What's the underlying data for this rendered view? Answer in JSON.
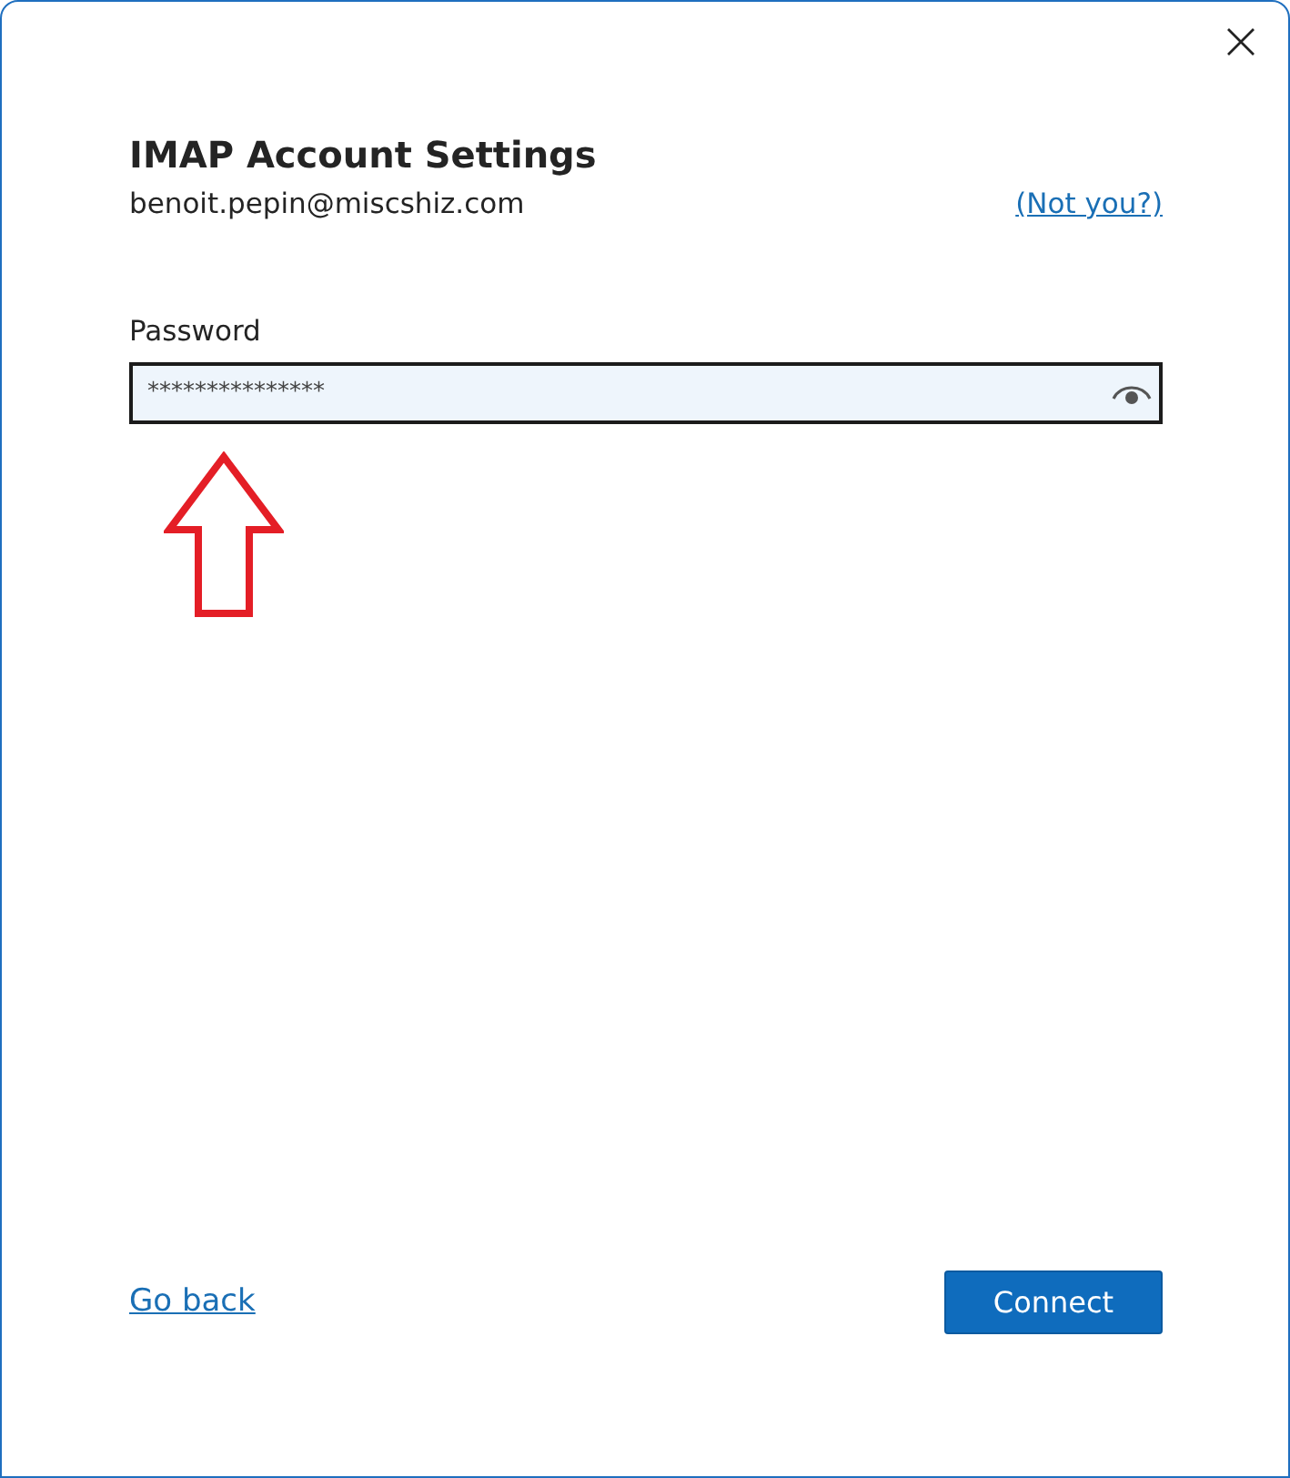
{
  "dialog": {
    "title": "IMAP Account Settings",
    "account": "benoit.pepin@miscshiz.com",
    "not_you_link": "(Not you?)"
  },
  "password": {
    "label": "Password",
    "value": "***************"
  },
  "footer": {
    "back_link": "Go back",
    "primary_button": "Connect"
  }
}
